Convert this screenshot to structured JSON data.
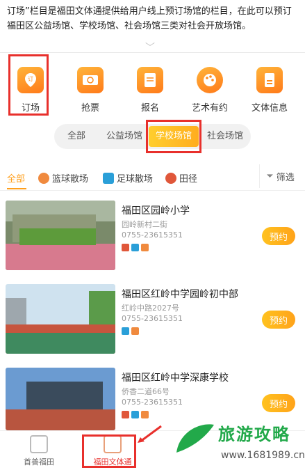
{
  "intro": {
    "text": "订场”栏目是福田文体通提供给用户线上预订场馆的栏目，在此可以预订福田区公益场馆、学校场馆、社会场馆三类对社会开放场馆。"
  },
  "nav": {
    "items": [
      {
        "label": "订场",
        "icon": "venue-booking-icon"
      },
      {
        "label": "抢票",
        "icon": "ticket-icon"
      },
      {
        "label": "报名",
        "icon": "signup-icon"
      },
      {
        "label": "艺术有约",
        "icon": "palette-icon"
      },
      {
        "label": "文体信息",
        "icon": "info-doc-icon"
      }
    ]
  },
  "segments": {
    "items": [
      "全部",
      "公益场馆",
      "学校场馆",
      "社会场馆"
    ],
    "selected": "学校场馆"
  },
  "filters": {
    "items": [
      "全部",
      "篮球散场",
      "足球散场",
      "田径"
    ],
    "filter_label": "筛选"
  },
  "venues": [
    {
      "name": "福田区园岭小学",
      "address": "园岭新村二街",
      "phone": "0755-23615351",
      "book_label": "预约"
    },
    {
      "name": "福田区红岭中学园岭初中部",
      "address": "红岭中路2027号",
      "phone": "0755-23615351",
      "book_label": "预约"
    },
    {
      "name": "福田区红岭中学深康学校",
      "address": "侨香二道66号",
      "phone": "0755-23615351",
      "book_label": "预约"
    }
  ],
  "bottom_tabs": [
    {
      "label": "首善福田",
      "active": false
    },
    {
      "label": "福田文体通",
      "active": true
    }
  ],
  "watermark": {
    "title": "旅游攻略",
    "url": "www.1681989.cn"
  },
  "colors": {
    "accent": "#ffa31a",
    "highlight": "#e8302c",
    "brand_green": "#22a94a"
  }
}
